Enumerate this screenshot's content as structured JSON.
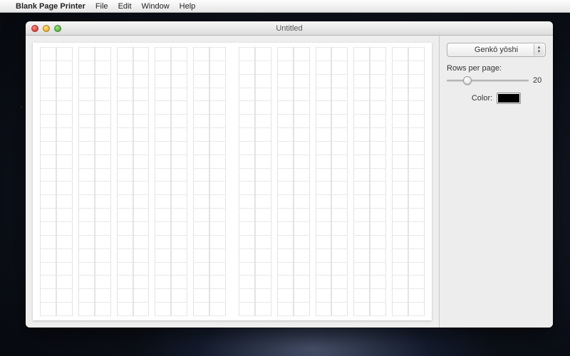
{
  "menubar": {
    "apple_glyph": "",
    "app_name": "Blank Page Printer",
    "items": [
      "File",
      "Edit",
      "Window",
      "Help"
    ]
  },
  "window": {
    "title": "Untitled"
  },
  "sidebar": {
    "template_selected": "Genkō yōshi",
    "rows_label": "Rows per page:",
    "rows_value": "20",
    "rows_min": 10,
    "rows_max": 50,
    "color_label": "Color:",
    "color_value": "#000000"
  },
  "page": {
    "rows": 20,
    "column_pairs": 10
  }
}
